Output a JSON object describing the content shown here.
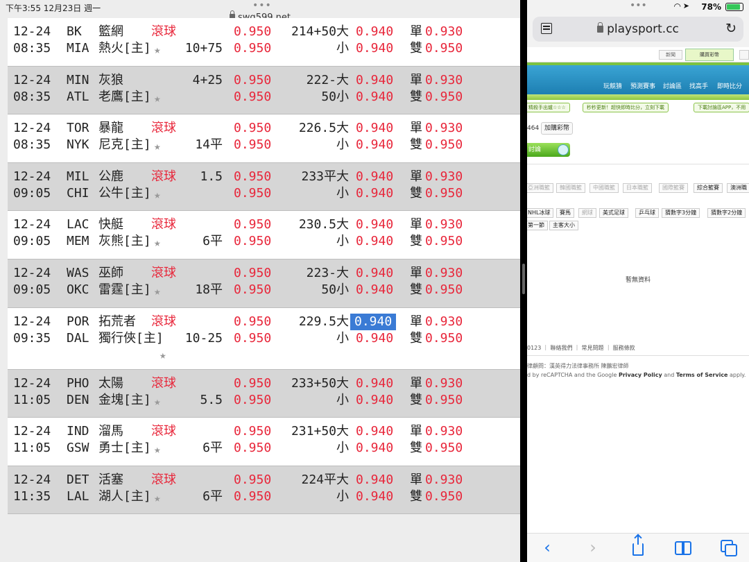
{
  "left_status": {
    "time": "下午3:55   12月23日 週一",
    "url": "swq599.net"
  },
  "games": [
    {
      "date": "12-24",
      "time": "08:35",
      "away": "BK",
      "away_name": "籃網",
      "home": "MIA",
      "home_name": "熱火[主]",
      "live": "滾球",
      "spread": "10+75",
      "spread_on": "home",
      "o1": "0.950",
      "o2": "0.950",
      "total": "214+50大",
      "total2": "小",
      "t1": "0.940",
      "t2": "0.940",
      "odd": "單",
      "even": "雙",
      "e1": "0.930",
      "e2": "0.950"
    },
    {
      "date": "12-24",
      "time": "08:35",
      "away": "MIN",
      "away_name": "灰狼",
      "home": "ATL",
      "home_name": "老鷹[主]",
      "live": "",
      "spread": "4+25",
      "spread_on": "away",
      "o1": "0.950",
      "o2": "0.950",
      "total": "222-大",
      "total2": "50小",
      "t1": "0.940",
      "t2": "0.940",
      "odd": "單",
      "even": "雙",
      "e1": "0.930",
      "e2": "0.950"
    },
    {
      "date": "12-24",
      "time": "08:35",
      "away": "TOR",
      "away_name": "暴龍",
      "home": "NYK",
      "home_name": "尼克[主]",
      "live": "滾球",
      "spread": "14平",
      "spread_on": "home",
      "o1": "0.950",
      "o2": "0.950",
      "total": "226.5大",
      "total2": "小",
      "t1": "0.940",
      "t2": "0.940",
      "odd": "單",
      "even": "雙",
      "e1": "0.930",
      "e2": "0.950"
    },
    {
      "date": "12-24",
      "time": "09:05",
      "away": "MIL",
      "away_name": "公鹿",
      "home": "CHI",
      "home_name": "公牛[主]",
      "live": "滾球",
      "spread": "1.5",
      "spread_on": "away",
      "o1": "0.950",
      "o2": "0.950",
      "total": "233平大",
      "total2": "小",
      "t1": "0.940",
      "t2": "0.940",
      "odd": "單",
      "even": "雙",
      "e1": "0.930",
      "e2": "0.950"
    },
    {
      "date": "12-24",
      "time": "09:05",
      "away": "LAC",
      "away_name": "快艇",
      "home": "MEM",
      "home_name": "灰熊[主]",
      "live": "滾球",
      "spread": "6平",
      "spread_on": "home",
      "o1": "0.950",
      "o2": "0.950",
      "total": "230.5大",
      "total2": "小",
      "t1": "0.940",
      "t2": "0.940",
      "odd": "單",
      "even": "雙",
      "e1": "0.930",
      "e2": "0.950"
    },
    {
      "date": "12-24",
      "time": "09:05",
      "away": "WAS",
      "away_name": "巫師",
      "home": "OKC",
      "home_name": "雷霆[主]",
      "live": "滾球",
      "spread": "18平",
      "spread_on": "home",
      "o1": "0.950",
      "o2": "0.950",
      "total": "223-大",
      "total2": "50小",
      "t1": "0.940",
      "t2": "0.940",
      "odd": "單",
      "even": "雙",
      "e1": "0.930",
      "e2": "0.950"
    },
    {
      "date": "12-24",
      "time": "09:35",
      "away": "POR",
      "away_name": "拓荒者",
      "home": "DAL",
      "home_name": "獨行俠[主]",
      "live": "滾球",
      "spread": "10-25",
      "spread_on": "home",
      "o1": "0.950",
      "o2": "0.950",
      "total": "229.5大",
      "total2": "小",
      "t1": "0.940",
      "t2": "0.940",
      "odd": "單",
      "even": "雙",
      "e1": "0.930",
      "e2": "0.950",
      "highlight": true
    },
    {
      "date": "12-24",
      "time": "11:05",
      "away": "PHO",
      "away_name": "太陽",
      "home": "DEN",
      "home_name": "金塊[主]",
      "live": "滾球",
      "spread": "5.5",
      "spread_on": "home",
      "o1": "0.950",
      "o2": "0.950",
      "total": "233+50大",
      "total2": "小",
      "t1": "0.940",
      "t2": "0.940",
      "odd": "單",
      "even": "雙",
      "e1": "0.930",
      "e2": "0.950"
    },
    {
      "date": "12-24",
      "time": "11:05",
      "away": "IND",
      "away_name": "溜馬",
      "home": "GSW",
      "home_name": "勇士[主]",
      "live": "滾球",
      "spread": "6平",
      "spread_on": "home",
      "o1": "0.950",
      "o2": "0.950",
      "total": "231+50大",
      "total2": "小",
      "t1": "0.940",
      "t2": "0.940",
      "odd": "單",
      "even": "雙",
      "e1": "0.930",
      "e2": "0.950"
    },
    {
      "date": "12-24",
      "time": "11:35",
      "away": "DET",
      "away_name": "活塞",
      "home": "LAL",
      "home_name": "湖人[主]",
      "live": "滾球",
      "spread": "6平",
      "spread_on": "home",
      "o1": "0.950",
      "o2": "0.950",
      "total": "224平大",
      "total2": "小",
      "t1": "0.940",
      "t2": "0.940",
      "odd": "單",
      "even": "雙",
      "e1": "0.930",
      "e2": "0.950"
    }
  ],
  "right_status": {
    "battery": "78%",
    "battery_level": 0.78
  },
  "address_bar": {
    "domain": "playsport.cc"
  },
  "site": {
    "top_btn1": "新聞",
    "top_btn2": "購買彩幣",
    "nav": [
      "玩競猜",
      "預測賽事",
      "討論區",
      "找高手",
      "即時比分"
    ],
    "ticks": [
      "精殺手出爐☆☆☆",
      "秒秒更新！超快即時比分，立刻下載",
      "下載討論區APP，不用"
    ],
    "account_num": "464",
    "buy_coins": "加購彩幣",
    "discuss": "討論",
    "cats_row1": [
      "亞洲職籃",
      "韓國職籃",
      "中國職籃",
      "日本職籃",
      "國際籃賽",
      "綜合籃賽",
      "澳洲職"
    ],
    "cats_row2": [
      "NHL冰球",
      "賽馬",
      "網球",
      "美式足球",
      "乒乓球",
      "猜數字3分鐘",
      "猜數字2分鐘"
    ],
    "cats_row3": [
      "第一節",
      "主客大小"
    ],
    "no_data": "暫無資料",
    "footer_links": "0123 ｜ 聯絡我們 ｜ 常見問題 ｜ 服務條款",
    "legal": "律顧問：漢英得力法律事務所 陳鵬宏律師",
    "recaptcha_pre": "d by reCAPTCHA and the Google ",
    "privacy": "Privacy Policy",
    "recaptcha_and": " and ",
    "terms": "Terms of Service",
    "recaptcha_post": " apply."
  }
}
